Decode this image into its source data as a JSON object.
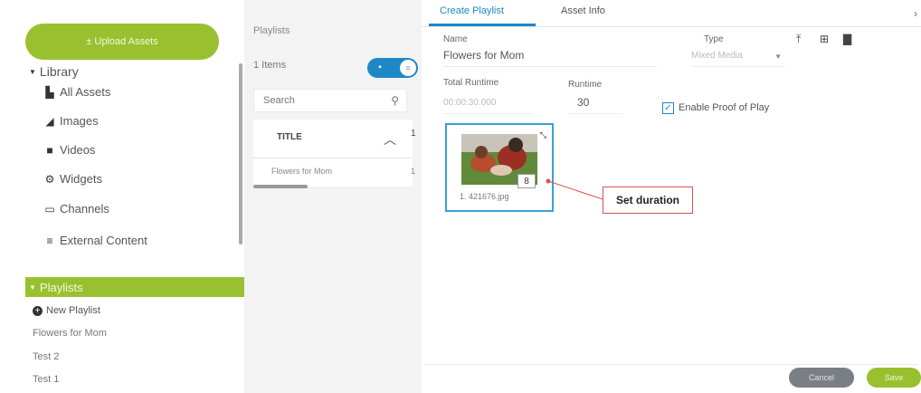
{
  "sidebar": {
    "upload_label": "± Upload Assets",
    "library_label": "Library",
    "library_items": [
      {
        "label": "All Assets",
        "icon": "document-icon"
      },
      {
        "label": "Images",
        "icon": "image-icon"
      },
      {
        "label": "Videos",
        "icon": "video-icon"
      },
      {
        "label": "Widgets",
        "icon": "gear-icon"
      },
      {
        "label": "Channels",
        "icon": "monitor-icon"
      },
      {
        "label": "External Content",
        "icon": "external-content-icon"
      }
    ],
    "playlists_label": "Playlists",
    "new_playlist_label": "New Playlist",
    "playlist_items": [
      "Flowers for Mom",
      "Test 2",
      "Test 1"
    ],
    "accent_color": "#99c12f"
  },
  "middle": {
    "title": "Playlists",
    "item_count": "1 Items",
    "search_placeholder": "Search",
    "column_title": "TITLE",
    "column_extra": "1",
    "row_name": "Flowers for Mom",
    "row_extra": "1"
  },
  "editor": {
    "tabs": [
      {
        "label": "Create Playlist",
        "active": true
      },
      {
        "label": "Asset Info",
        "active": false
      }
    ],
    "name_label": "Name",
    "name_value": "Flowers for Mom",
    "type_label": "Type",
    "type_value": "Mixed Media",
    "total_runtime_label": "Total Runtime",
    "total_runtime_value": "00:00:30.000",
    "runtime_label": "Runtime",
    "runtime_value": "30",
    "proof_of_play_label": "Enable Proof of Play",
    "proof_of_play_checked": true,
    "asset": {
      "duration": "8",
      "caption": "1.  421676.jpg"
    },
    "callout_text": "Set duration",
    "cancel_label": "Cancel",
    "save_label": "Save",
    "link_color": "#1e88c7"
  }
}
